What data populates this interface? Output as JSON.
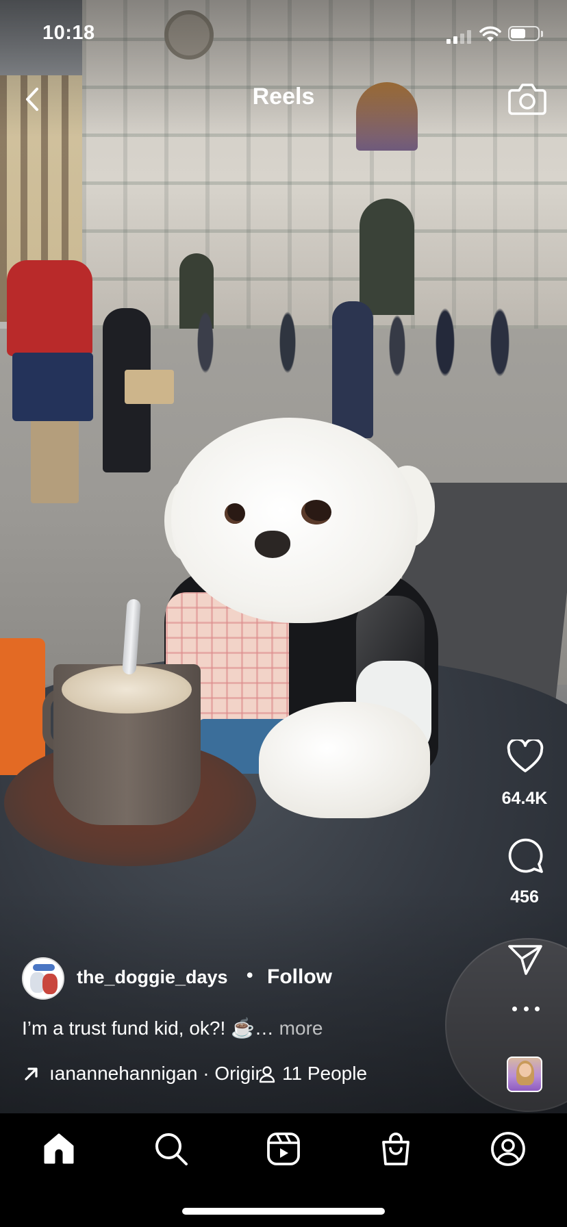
{
  "status_bar": {
    "time": "10:18",
    "battery_level": 0.55
  },
  "header": {
    "title": "Reels",
    "back_icon": "chevron-left-icon",
    "camera_icon": "camera-icon"
  },
  "actions": {
    "like": {
      "icon": "heart-icon",
      "count": "64.4K"
    },
    "comment": {
      "icon": "comment-icon",
      "count": "456"
    },
    "share": {
      "icon": "send-icon"
    },
    "more": {
      "icon": "more-dots-icon"
    },
    "audio_thumbnail": {
      "icon": "audio-thumbnail"
    }
  },
  "post": {
    "username": "the_doggie_days",
    "separator": "•",
    "follow_label": "Follow",
    "caption": "I’m a trust fund kid, ok?! ☕️…",
    "more_label": "more",
    "audio_text": "ıanannehannigan · Original audio",
    "people_label": "11 People"
  },
  "tabs": [
    {
      "name": "home",
      "icon": "home-icon",
      "active": true
    },
    {
      "name": "search",
      "icon": "search-icon",
      "active": false
    },
    {
      "name": "reels",
      "icon": "reels-icon",
      "active": false
    },
    {
      "name": "shop",
      "icon": "shop-bag-icon",
      "active": false
    },
    {
      "name": "profile",
      "icon": "profile-icon",
      "active": false
    }
  ],
  "colors": {
    "tab_bar_bg": "#000000",
    "text": "#ffffff",
    "more_text": "#b3b3b3"
  }
}
